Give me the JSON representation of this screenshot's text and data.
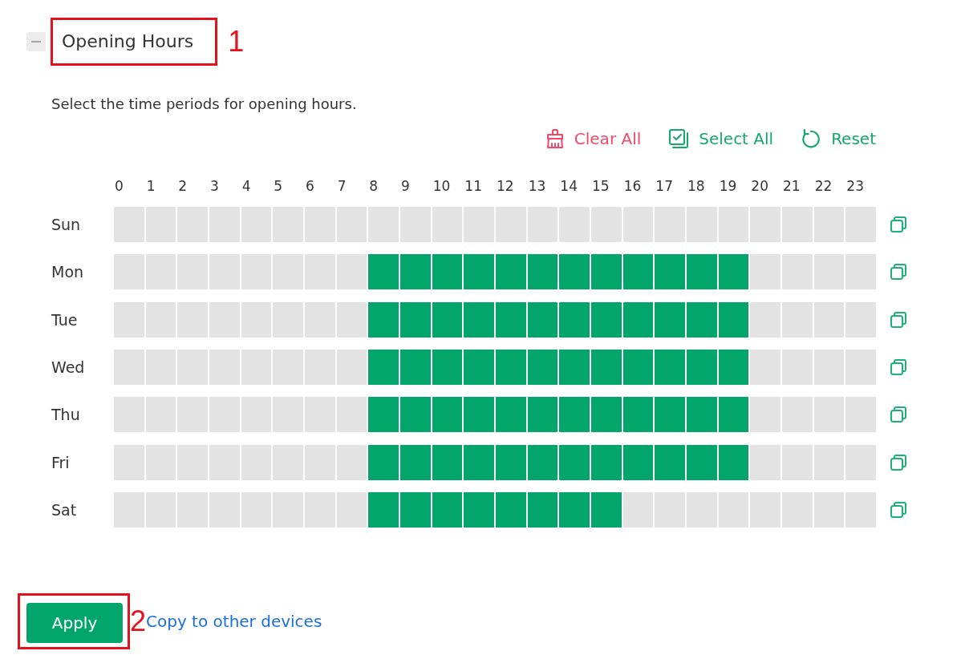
{
  "section": {
    "title": "Opening Hours",
    "expanded": true,
    "callout": "1"
  },
  "description": "Select the time periods for opening hours.",
  "actions": [
    {
      "kind": "clear",
      "label": "Clear All"
    },
    {
      "kind": "select",
      "label": "Select All"
    },
    {
      "kind": "reset",
      "label": "Reset"
    }
  ],
  "hours": [
    "0",
    "1",
    "2",
    "3",
    "4",
    "5",
    "6",
    "7",
    "8",
    "9",
    "10",
    "11",
    "12",
    "13",
    "14",
    "15",
    "16",
    "17",
    "18",
    "19",
    "20",
    "21",
    "22",
    "23"
  ],
  "days": [
    {
      "label": "Sun",
      "cells": [
        {
          "selected": false
        },
        {
          "selected": false
        },
        {
          "selected": false
        },
        {
          "selected": false
        },
        {
          "selected": false
        },
        {
          "selected": false
        },
        {
          "selected": false
        },
        {
          "selected": false
        },
        {
          "selected": false
        },
        {
          "selected": false
        },
        {
          "selected": false
        },
        {
          "selected": false
        },
        {
          "selected": false
        },
        {
          "selected": false
        },
        {
          "selected": false
        },
        {
          "selected": false
        },
        {
          "selected": false
        },
        {
          "selected": false
        },
        {
          "selected": false
        },
        {
          "selected": false
        },
        {
          "selected": false
        },
        {
          "selected": false
        },
        {
          "selected": false
        },
        {
          "selected": false
        }
      ]
    },
    {
      "label": "Mon",
      "cells": [
        {
          "selected": false
        },
        {
          "selected": false
        },
        {
          "selected": false
        },
        {
          "selected": false
        },
        {
          "selected": false
        },
        {
          "selected": false
        },
        {
          "selected": false
        },
        {
          "selected": false
        },
        {
          "selected": true
        },
        {
          "selected": true
        },
        {
          "selected": true
        },
        {
          "selected": true
        },
        {
          "selected": true
        },
        {
          "selected": true
        },
        {
          "selected": true
        },
        {
          "selected": true
        },
        {
          "selected": true
        },
        {
          "selected": true
        },
        {
          "selected": true
        },
        {
          "selected": true
        },
        {
          "selected": false
        },
        {
          "selected": false
        },
        {
          "selected": false
        },
        {
          "selected": false
        }
      ]
    },
    {
      "label": "Tue",
      "cells": [
        {
          "selected": false
        },
        {
          "selected": false
        },
        {
          "selected": false
        },
        {
          "selected": false
        },
        {
          "selected": false
        },
        {
          "selected": false
        },
        {
          "selected": false
        },
        {
          "selected": false
        },
        {
          "selected": true
        },
        {
          "selected": true
        },
        {
          "selected": true
        },
        {
          "selected": true
        },
        {
          "selected": true
        },
        {
          "selected": true
        },
        {
          "selected": true
        },
        {
          "selected": true
        },
        {
          "selected": true
        },
        {
          "selected": true
        },
        {
          "selected": true
        },
        {
          "selected": true
        },
        {
          "selected": false
        },
        {
          "selected": false
        },
        {
          "selected": false
        },
        {
          "selected": false
        }
      ]
    },
    {
      "label": "Wed",
      "cells": [
        {
          "selected": false
        },
        {
          "selected": false
        },
        {
          "selected": false
        },
        {
          "selected": false
        },
        {
          "selected": false
        },
        {
          "selected": false
        },
        {
          "selected": false
        },
        {
          "selected": false
        },
        {
          "selected": true
        },
        {
          "selected": true
        },
        {
          "selected": true
        },
        {
          "selected": true
        },
        {
          "selected": true
        },
        {
          "selected": true
        },
        {
          "selected": true
        },
        {
          "selected": true
        },
        {
          "selected": true
        },
        {
          "selected": true
        },
        {
          "selected": true
        },
        {
          "selected": true
        },
        {
          "selected": false
        },
        {
          "selected": false
        },
        {
          "selected": false
        },
        {
          "selected": false
        }
      ]
    },
    {
      "label": "Thu",
      "cells": [
        {
          "selected": false
        },
        {
          "selected": false
        },
        {
          "selected": false
        },
        {
          "selected": false
        },
        {
          "selected": false
        },
        {
          "selected": false
        },
        {
          "selected": false
        },
        {
          "selected": false
        },
        {
          "selected": true
        },
        {
          "selected": true
        },
        {
          "selected": true
        },
        {
          "selected": true
        },
        {
          "selected": true
        },
        {
          "selected": true
        },
        {
          "selected": true
        },
        {
          "selected": true
        },
        {
          "selected": true
        },
        {
          "selected": true
        },
        {
          "selected": true
        },
        {
          "selected": true
        },
        {
          "selected": false
        },
        {
          "selected": false
        },
        {
          "selected": false
        },
        {
          "selected": false
        }
      ]
    },
    {
      "label": "Fri",
      "cells": [
        {
          "selected": false
        },
        {
          "selected": false
        },
        {
          "selected": false
        },
        {
          "selected": false
        },
        {
          "selected": false
        },
        {
          "selected": false
        },
        {
          "selected": false
        },
        {
          "selected": false
        },
        {
          "selected": true
        },
        {
          "selected": true
        },
        {
          "selected": true
        },
        {
          "selected": true
        },
        {
          "selected": true
        },
        {
          "selected": true
        },
        {
          "selected": true
        },
        {
          "selected": true
        },
        {
          "selected": true
        },
        {
          "selected": true
        },
        {
          "selected": true
        },
        {
          "selected": true
        },
        {
          "selected": false
        },
        {
          "selected": false
        },
        {
          "selected": false
        },
        {
          "selected": false
        }
      ]
    },
    {
      "label": "Sat",
      "cells": [
        {
          "selected": false
        },
        {
          "selected": false
        },
        {
          "selected": false
        },
        {
          "selected": false
        },
        {
          "selected": false
        },
        {
          "selected": false
        },
        {
          "selected": false
        },
        {
          "selected": false
        },
        {
          "selected": true
        },
        {
          "selected": true
        },
        {
          "selected": true
        },
        {
          "selected": true
        },
        {
          "selected": true
        },
        {
          "selected": true
        },
        {
          "selected": true
        },
        {
          "selected": true
        },
        {
          "selected": false
        },
        {
          "selected": false
        },
        {
          "selected": false
        },
        {
          "selected": false
        },
        {
          "selected": false
        },
        {
          "selected": false
        },
        {
          "selected": false
        },
        {
          "selected": false
        }
      ]
    }
  ],
  "footer": {
    "apply": {
      "label": "Apply",
      "callout": "2"
    },
    "link": "Copy to other devices"
  }
}
